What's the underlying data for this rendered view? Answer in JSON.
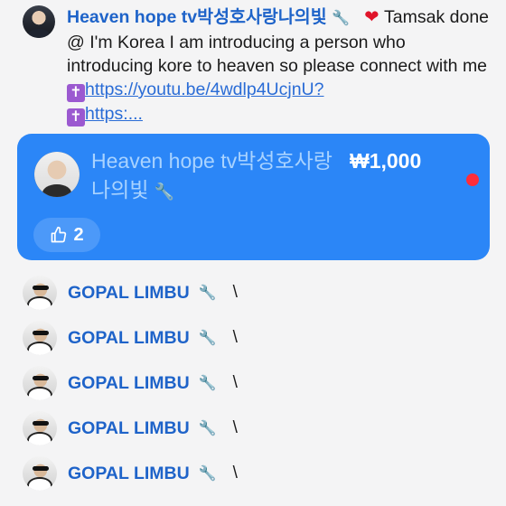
{
  "comment": {
    "author": "Heaven hope tv박성호사랑나의빛",
    "body_pre": " Tamsak done @ I'm Korea I am introducing a person who introducing kore to heaven so please connect with me",
    "link1": "https://youtu.be/4wdlp4UcjnU?",
    "link2": "https:..."
  },
  "donation": {
    "author": "Heaven hope tv박성호사랑나의빛",
    "amount": "₩1,000",
    "likes": "2"
  },
  "replies": [
    {
      "name": "GOPAL LIMBU",
      "text": "\\"
    },
    {
      "name": "GOPAL LIMBU",
      "text": "\\"
    },
    {
      "name": "GOPAL LIMBU",
      "text": "\\"
    },
    {
      "name": "GOPAL LIMBU",
      "text": "\\"
    },
    {
      "name": "GOPAL LIMBU",
      "text": "\\"
    }
  ],
  "colors": {
    "accent": "#2b86f7",
    "author": "#1e63c9",
    "heart": "#e0142a"
  },
  "icons": [
    "wrench-icon",
    "heart-icon",
    "cross-icon",
    "thumbs-up-icon"
  ]
}
